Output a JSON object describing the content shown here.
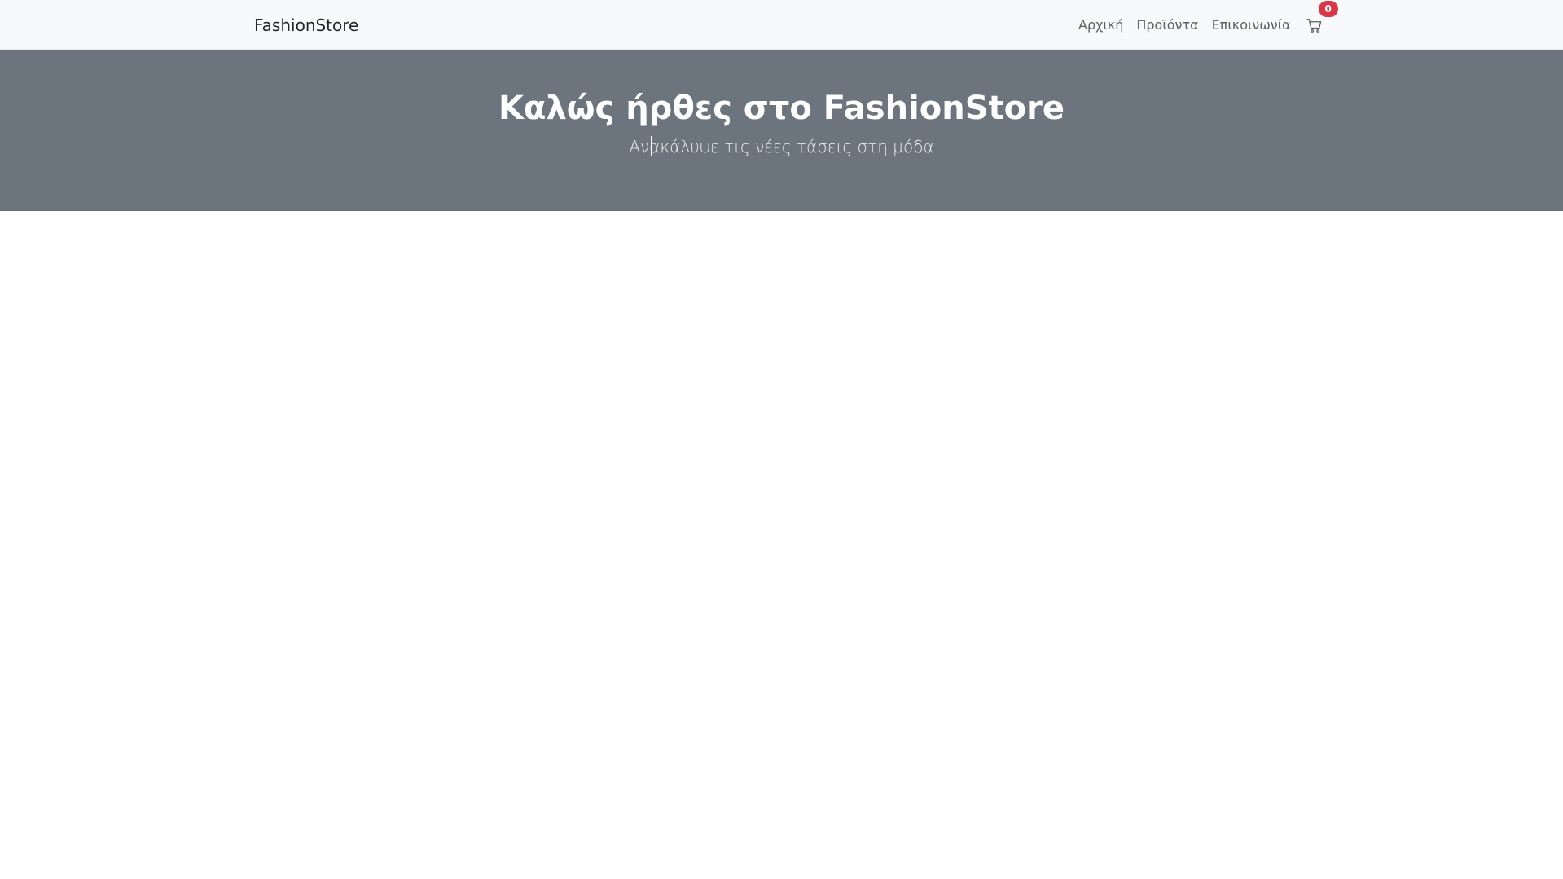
{
  "navbar": {
    "brand": "FashionStore",
    "links": [
      {
        "label": "Αρχική"
      },
      {
        "label": "Προϊόντα"
      },
      {
        "label": "Επικοινωνία"
      }
    ],
    "cart": {
      "icon": "cart-icon",
      "count": "0",
      "badge_color": "#dc3545"
    },
    "background": "#f8f9fa"
  },
  "hero": {
    "title": "Καλώς ήρθες στο FashionStore",
    "subtitle": "Ανακάλυψε τις νέες τάσεις στη μόδα",
    "background": "#6c757d"
  }
}
